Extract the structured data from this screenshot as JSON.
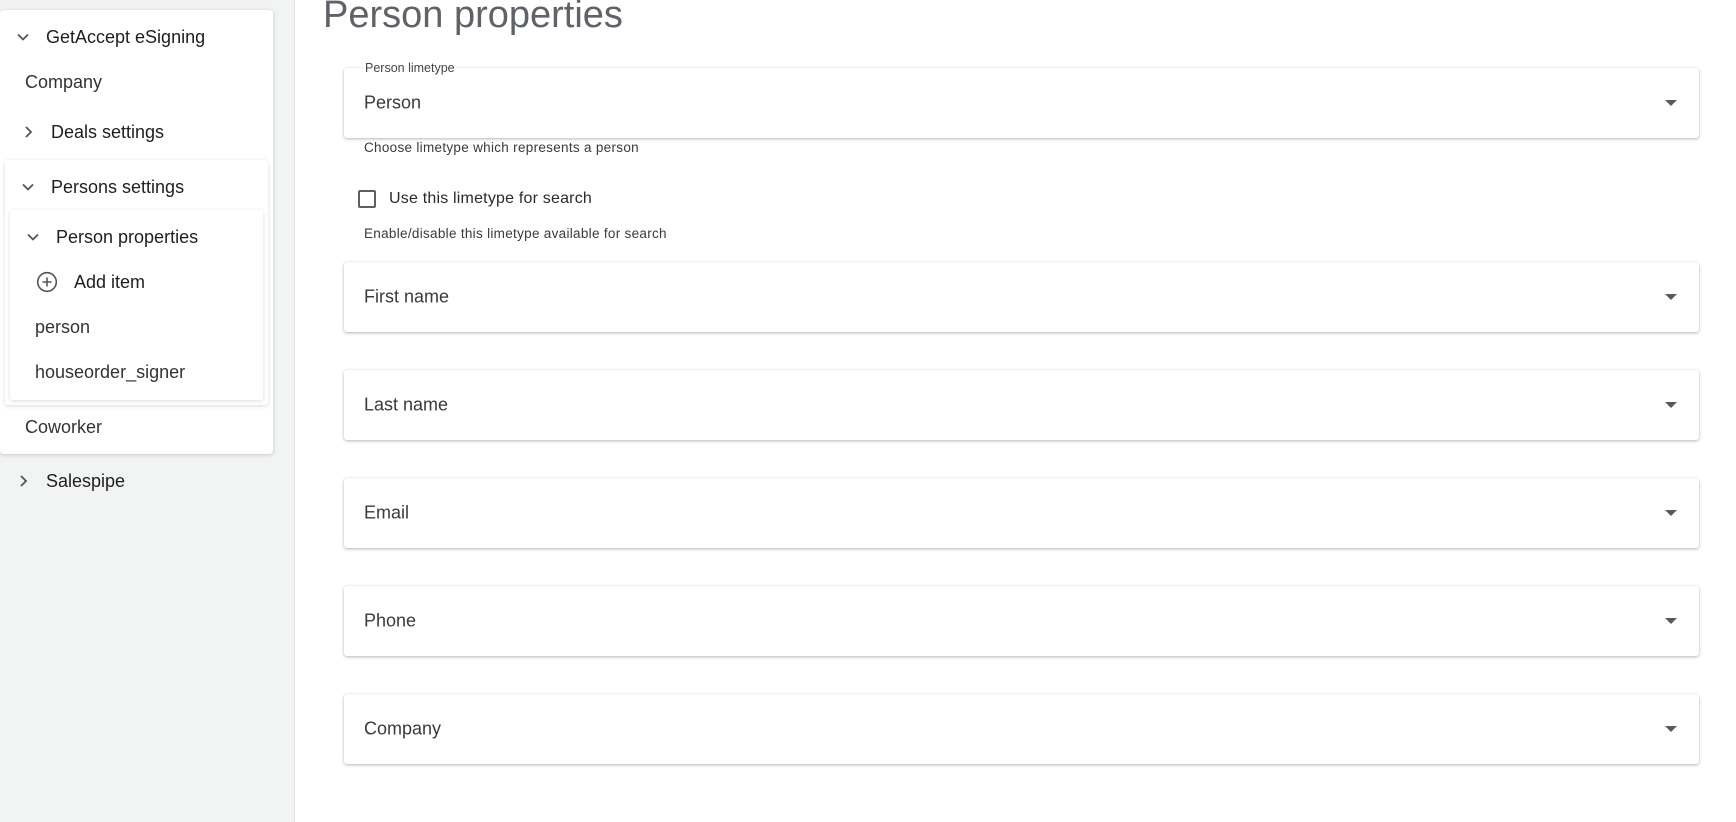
{
  "sidebar": {
    "root": {
      "label": "GetAccept eSigning",
      "expanded": true
    },
    "company": {
      "label": "Company"
    },
    "deals": {
      "label": "Deals settings",
      "expanded": false
    },
    "persons": {
      "label": "Persons settings",
      "expanded": true,
      "properties": {
        "label": "Person properties",
        "expanded": true,
        "add_item": "Add item",
        "items": [
          "person",
          "houseorder_signer"
        ]
      }
    },
    "coworker": {
      "label": "Coworker"
    },
    "salespipe": {
      "label": "Salespipe",
      "expanded": false
    }
  },
  "main": {
    "title": "Person properties",
    "limetype": {
      "label": "Person limetype",
      "value": "Person",
      "helper": "Choose limetype which represents a person"
    },
    "search_checkbox": {
      "label": "Use this limetype for search",
      "checked": false,
      "helper": "Enable/disable this limetype available for search"
    },
    "fields": [
      {
        "placeholder": "First name"
      },
      {
        "placeholder": "Last name"
      },
      {
        "placeholder": "Email"
      },
      {
        "placeholder": "Phone"
      },
      {
        "placeholder": "Company"
      }
    ]
  },
  "icons": {
    "expand": "chevron-down-icon",
    "collapse": "chevron-right-icon",
    "add": "plus-circle-icon",
    "dropdown": "caret-down-icon"
  },
  "colors": {
    "sidebar_bg": "#f2f3f3",
    "title": "#5f6266",
    "text": "#212121"
  }
}
